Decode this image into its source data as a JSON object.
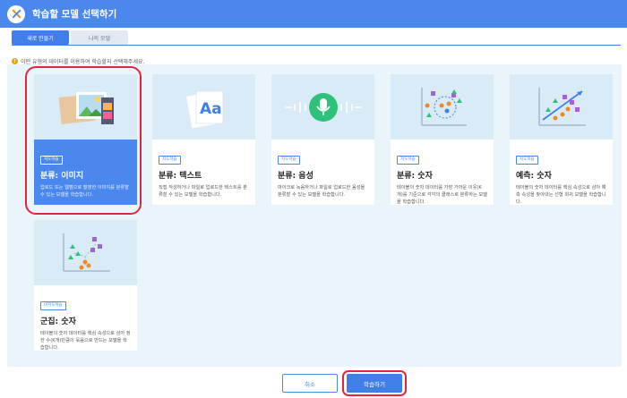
{
  "window": {
    "title": "학습할 모델 선택하기",
    "logo_icon": "x-tools-icon"
  },
  "tabs": [
    {
      "label": "새로 만들기",
      "active": true
    },
    {
      "label": "나의 모델",
      "active": false
    }
  ],
  "info_text": "이떤 유형의 데이터를 이용하여 학습할지 선택해주세요.",
  "cards": [
    {
      "badge": "지도학습",
      "title": "분류: 이미지",
      "description": "업로드 또는 웹캠으로 촬영한 이미지를 분류할 수 있는 모델을 학습합니다.",
      "icon": "image-gallery-icon",
      "selected": true
    },
    {
      "badge": "지도학습",
      "title": "분류: 텍스트",
      "description": "직접 작성하거나 파일로 업로드한 텍스트를 분류할 수 있는 모델을 학습합니다.",
      "icon": "text-document-icon",
      "selected": false
    },
    {
      "badge": "지도학습",
      "title": "분류: 음성",
      "description": "마이크로 녹음하거나 파일로 업로드한 음성을 분류할 수 있는 모델을 학습합니다.",
      "icon": "microphone-icon",
      "selected": false
    },
    {
      "badge": "지도학습",
      "title": "분류: 숫자",
      "description": "테이블의 숫자 데이터를 가장 가까운 이웃(K개)를 기준으로 각각의 클래스로 분류하는 모델을 학습합니다.",
      "icon": "scatter-classes-icon",
      "selected": false
    },
    {
      "badge": "지도학습",
      "title": "예측: 숫자",
      "description": "테이블의 숫자 데이터를 핵심 속성으로 삼아 예측 속성을 찾아내는 선형 회귀 모델을 학습합니다.",
      "icon": "regression-chart-icon",
      "selected": false
    },
    {
      "badge": "비지도학습",
      "title": "군집: 숫자",
      "description": "테이블의 숫자 데이터를 핵심 속성으로 삼아 정한 수(K개)만큼의 묶음으로 만드는 모델을 학습합니다.",
      "icon": "cluster-chart-icon",
      "selected": false
    }
  ],
  "buttons": {
    "cancel": "취소",
    "learn": "학습하기"
  },
  "colors": {
    "brand": "#4b88ee",
    "highlight_ring": "#e0263c",
    "panel": "#eaf4fb"
  }
}
